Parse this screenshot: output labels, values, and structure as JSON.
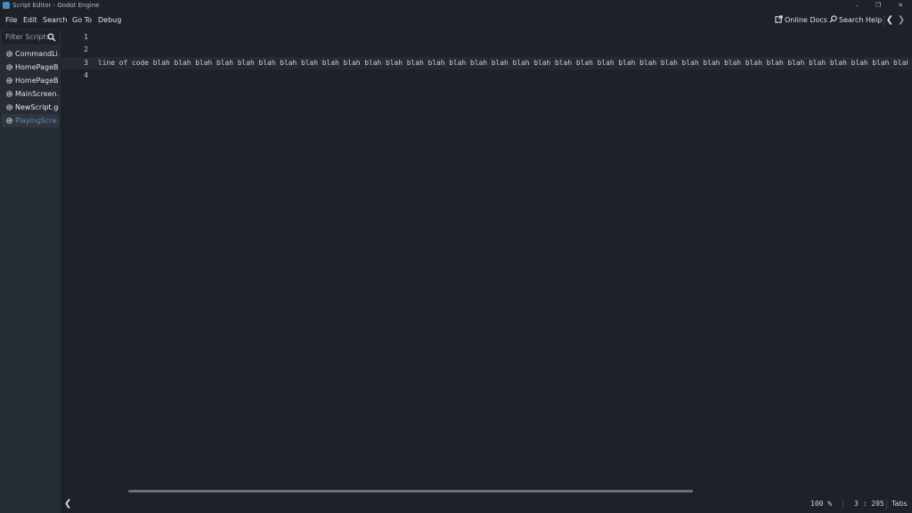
{
  "window": {
    "title": "Script Editor - Godot Engine",
    "minimize": "–",
    "maximize": "❐",
    "close": "✕"
  },
  "menu": {
    "items": [
      "File",
      "Edit",
      "Search",
      "Go To",
      "Debug"
    ],
    "online_docs": "Online Docs",
    "search_help": "Search Help",
    "nav_back": "❮",
    "nav_forward": "❯"
  },
  "sidebar": {
    "filter_placeholder": "Filter Scripts",
    "scripts": [
      {
        "label": "CommandLi…"
      },
      {
        "label": "HomePageB…"
      },
      {
        "label": "HomePageB…"
      },
      {
        "label": "MainScreen.…"
      },
      {
        "label": "NewScript.gd"
      },
      {
        "label": "PlayingScre…"
      }
    ]
  },
  "editor": {
    "line_numbers": [
      "1",
      "2",
      "3",
      "4"
    ],
    "lines": [
      "",
      "",
      "line of code blah blah blah blah blah blah blah blah blah blah blah blah blah blah blah blah blah blah blah blah blah blah blah blah blah blah blah blah blah blah blah blah blah blah blah blah blah b",
      ""
    ],
    "current_line": 3
  },
  "status": {
    "collapse": "❮",
    "zoom": "100 %",
    "cursor": "3 :  205",
    "indent": "Tabs"
  },
  "colors": {
    "background": "#1d2229",
    "sidebar": "#262c35",
    "selected_script": "#5e89b5",
    "current_line": "#252a32"
  }
}
